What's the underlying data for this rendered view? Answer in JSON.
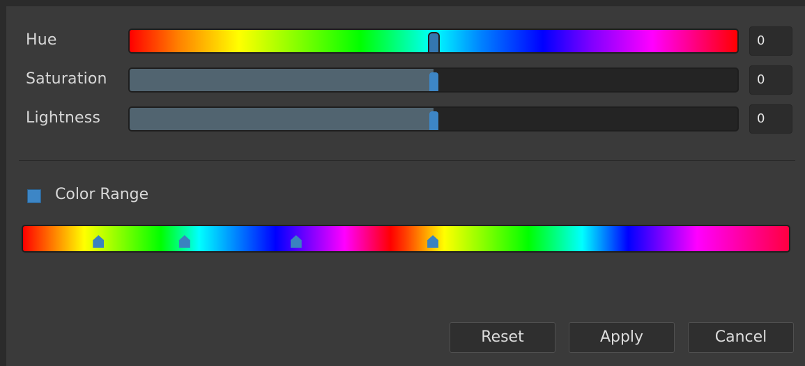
{
  "adjustments": {
    "hue": {
      "label": "Hue",
      "value": "0",
      "level": 0.5
    },
    "saturation": {
      "label": "Saturation",
      "value": "0",
      "level": 0.5
    },
    "lightness": {
      "label": "Lightness",
      "value": "0",
      "level": 0.5
    }
  },
  "color_range": {
    "label": "Color Range",
    "checked": true,
    "markers": [
      0.1,
      0.212,
      0.357,
      0.535
    ]
  },
  "buttons": {
    "reset": "Reset",
    "apply": "Apply",
    "cancel": "Cancel"
  },
  "colors": {
    "accent": "#3d86c6",
    "panel": "#3a3a3a",
    "fill": "#516470"
  }
}
